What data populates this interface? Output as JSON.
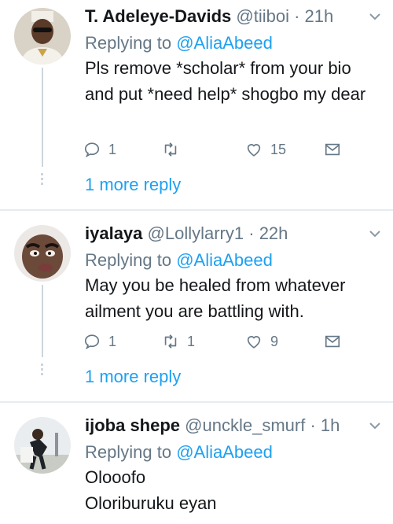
{
  "tweets": [
    {
      "name": "T. Adeleye-Davids",
      "handle": "@tiiboi",
      "time": "· 21h",
      "replying_prefix": "Replying to ",
      "replying_handle": "@AliaAbeed",
      "body": "Pls remove *scholar* from your bio and put *need help* shogbo my dear",
      "reply_count": "1",
      "retweet_count": "",
      "like_count": "15",
      "more_replies": "1 more reply"
    },
    {
      "name": "iyalaya",
      "handle": "@Lollylarry1",
      "time": "· 22h",
      "replying_prefix": "Replying to ",
      "replying_handle": "@AliaAbeed",
      "body": "May you be healed from whatever ailment you are battling with.",
      "reply_count": "1",
      "retweet_count": "1",
      "like_count": "9",
      "more_replies": "1 more reply"
    },
    {
      "name": "ijoba shepe",
      "handle": "@unckle_smurf",
      "time": "· 1h",
      "replying_prefix": "Replying to ",
      "replying_handle": "@AliaAbeed",
      "body_line1": "Olooofo",
      "body_line2": "Oloriburuku eyan"
    }
  ],
  "icons": {
    "reply": "reply-icon",
    "retweet": "retweet-icon",
    "like": "heart-icon",
    "dm": "envelope-icon",
    "menu": "chevron-down-icon"
  },
  "colors": {
    "link": "#1da1f2",
    "muted": "#657786",
    "text": "#14171a",
    "divider": "#e6ecf0"
  }
}
